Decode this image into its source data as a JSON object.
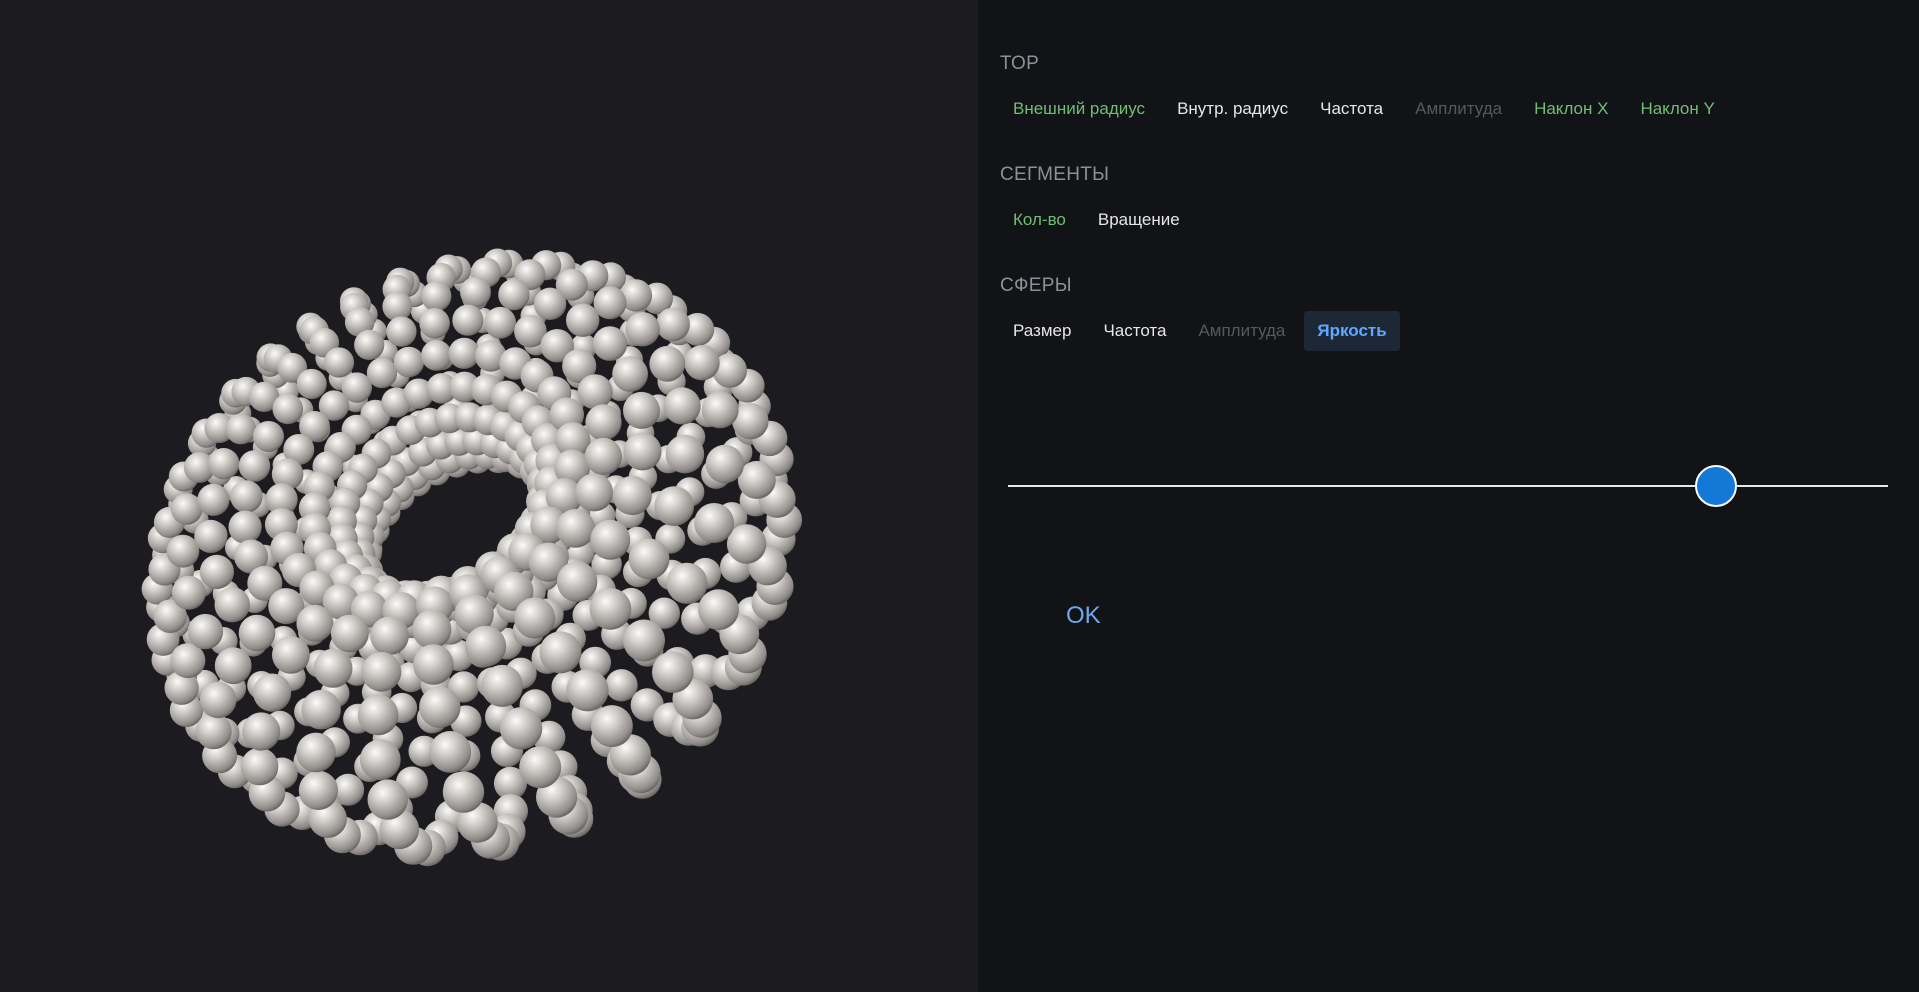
{
  "colors": {
    "set": "#6fbf73",
    "normal": "#e6e6e6",
    "dim": "#55585e",
    "active": "#5fa8ff",
    "slider_thumb": "#1479d6",
    "viewport_bg": "#1b1b20",
    "panel_bg": "#121317",
    "sphere": "#c9c6c2"
  },
  "groups": [
    {
      "title": "ТОР",
      "options": [
        {
          "label": "Внешний радиус",
          "state": "set"
        },
        {
          "label": "Внутр. радиус",
          "state": "normal"
        },
        {
          "label": "Частота",
          "state": "normal"
        },
        {
          "label": "Амплитуда",
          "state": "dim"
        },
        {
          "label": "Наклон X",
          "state": "set"
        },
        {
          "label": "Наклон Y",
          "state": "set"
        }
      ]
    },
    {
      "title": "СЕГМЕНТЫ",
      "options": [
        {
          "label": "Кол-во",
          "state": "set"
        },
        {
          "label": "Вращение",
          "state": "normal"
        }
      ]
    },
    {
      "title": "СФЕРЫ",
      "options": [
        {
          "label": "Размер",
          "state": "normal"
        },
        {
          "label": "Частота",
          "state": "normal"
        },
        {
          "label": "Амплитуда",
          "state": "dim"
        },
        {
          "label": "Яркость",
          "state": "active"
        }
      ]
    }
  ],
  "slider": {
    "value": 0.805
  },
  "ok_label": "OK"
}
